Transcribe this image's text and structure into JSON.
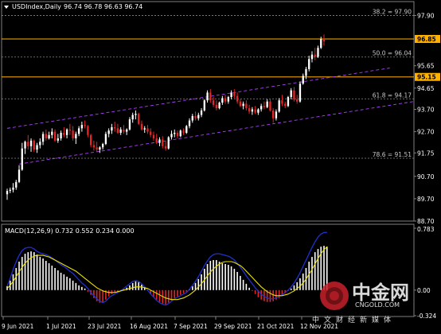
{
  "header": {
    "symbol": "USDIndex,Daily",
    "ohlc": "96.74 96.78 96.63 96.74"
  },
  "chart_data": [
    {
      "type": "candlestick",
      "title": "USDIndex,Daily",
      "ylim": [
        88.7,
        98.45
      ],
      "y_ticks": [
        "97.90",
        "96.85",
        "95.65",
        "95.15",
        "94.65",
        "93.70",
        "92.70",
        "91.75",
        "90.70",
        "89.70",
        "88.70"
      ],
      "x_ticks": [
        "9 Jun 2021",
        "1 Jul 2021",
        "23 Jul 2021",
        "16 Aug 2021",
        "7 Sep 2021",
        "29 Sep 2021",
        "21 Oct 2021",
        "12 Nov 2021"
      ],
      "fib_levels": [
        {
          "label": "38.2 = 97.90",
          "value": 97.9
        },
        {
          "label": "50.0 = 96.04",
          "value": 96.04
        },
        {
          "label": "61.8 = 94.17",
          "value": 94.17
        },
        {
          "label": "78.6 = 91.51",
          "value": 91.51
        }
      ],
      "horizontal_lines": [
        {
          "value": 96.85,
          "label": "96.85",
          "color": "#ffb000"
        },
        {
          "value": 95.15,
          "label": "95.15",
          "color": "#ffb000"
        }
      ],
      "channel": {
        "upper": [
          [
            0,
            92.85
          ],
          [
            128,
            95.55
          ]
        ],
        "lower": [
          [
            4,
            91.25
          ],
          [
            136,
            94.05
          ]
        ]
      },
      "candles": [
        [
          89.9,
          90.15,
          89.65,
          90.05
        ],
        [
          90.05,
          90.2,
          89.95,
          90.1
        ],
        [
          90.1,
          90.4,
          89.98,
          90.2
        ],
        [
          90.2,
          90.55,
          90.1,
          90.45
        ],
        [
          90.45,
          91.2,
          90.4,
          91.0
        ],
        [
          91.0,
          92.2,
          90.95,
          91.95
        ],
        [
          91.95,
          92.3,
          91.7,
          92.25
        ],
        [
          92.25,
          92.55,
          91.9,
          92.05
        ],
        [
          92.05,
          92.4,
          91.8,
          92.3
        ],
        [
          92.3,
          92.35,
          91.8,
          91.9
        ],
        [
          91.9,
          92.2,
          91.75,
          92.1
        ],
        [
          92.1,
          92.4,
          91.95,
          92.25
        ],
        [
          92.25,
          92.7,
          92.1,
          92.6
        ],
        [
          92.6,
          92.8,
          92.3,
          92.4
        ],
        [
          92.4,
          92.7,
          92.35,
          92.55
        ],
        [
          92.55,
          92.85,
          92.4,
          92.7
        ],
        [
          92.7,
          92.8,
          92.25,
          92.3
        ],
        [
          92.3,
          92.6,
          92.2,
          92.4
        ],
        [
          92.4,
          92.75,
          92.3,
          92.65
        ],
        [
          92.65,
          92.9,
          92.45,
          92.55
        ],
        [
          92.55,
          92.85,
          92.4,
          92.8
        ],
        [
          92.8,
          93.05,
          92.55,
          92.75
        ],
        [
          92.75,
          92.95,
          92.3,
          92.4
        ],
        [
          92.4,
          92.7,
          92.15,
          92.6
        ],
        [
          92.6,
          92.95,
          92.5,
          92.85
        ],
        [
          92.85,
          93.15,
          92.7,
          93.0
        ],
        [
          93.0,
          93.2,
          92.85,
          92.95
        ],
        [
          92.95,
          93.0,
          92.45,
          92.55
        ],
        [
          92.55,
          92.6,
          92.0,
          92.1
        ],
        [
          92.1,
          92.3,
          91.85,
          92.0
        ],
        [
          92.0,
          92.25,
          91.8,
          91.9
        ],
        [
          91.9,
          92.05,
          91.75,
          92.0
        ],
        [
          92.0,
          92.2,
          91.9,
          92.15
        ],
        [
          92.15,
          92.7,
          92.1,
          92.6
        ],
        [
          92.6,
          92.85,
          92.45,
          92.75
        ],
        [
          92.75,
          93.05,
          92.6,
          92.9
        ],
        [
          92.9,
          93.15,
          92.7,
          92.85
        ],
        [
          92.85,
          93.05,
          92.6,
          92.65
        ],
        [
          92.65,
          92.9,
          92.55,
          92.8
        ],
        [
          92.8,
          93.0,
          92.6,
          92.7
        ],
        [
          92.7,
          92.85,
          92.55,
          92.8
        ],
        [
          92.8,
          93.35,
          92.75,
          93.25
        ],
        [
          93.25,
          93.55,
          93.1,
          93.45
        ],
        [
          93.45,
          93.65,
          93.25,
          93.5
        ],
        [
          93.5,
          93.55,
          93.0,
          93.05
        ],
        [
          93.05,
          93.2,
          92.75,
          92.8
        ],
        [
          92.8,
          92.95,
          92.65,
          92.85
        ],
        [
          92.85,
          93.0,
          92.6,
          92.7
        ],
        [
          92.7,
          92.85,
          92.45,
          92.55
        ],
        [
          92.55,
          92.7,
          92.3,
          92.4
        ],
        [
          92.4,
          92.6,
          92.15,
          92.2
        ],
        [
          92.2,
          92.45,
          92.05,
          92.35
        ],
        [
          92.35,
          92.5,
          91.95,
          92.05
        ],
        [
          92.05,
          92.3,
          91.85,
          91.95
        ],
        [
          91.95,
          92.5,
          91.9,
          92.45
        ],
        [
          92.45,
          92.75,
          92.35,
          92.6
        ],
        [
          92.6,
          92.8,
          92.45,
          92.65
        ],
        [
          92.65,
          92.75,
          92.4,
          92.5
        ],
        [
          92.5,
          92.8,
          92.45,
          92.75
        ],
        [
          92.75,
          92.85,
          92.55,
          92.65
        ],
        [
          92.65,
          93.0,
          92.6,
          92.95
        ],
        [
          92.95,
          93.3,
          92.85,
          93.2
        ],
        [
          93.2,
          93.5,
          93.1,
          93.4
        ],
        [
          93.4,
          93.6,
          93.2,
          93.3
        ],
        [
          93.3,
          93.55,
          93.2,
          93.45
        ],
        [
          93.45,
          93.75,
          93.35,
          93.65
        ],
        [
          93.65,
          94.15,
          93.6,
          94.1
        ],
        [
          94.1,
          94.55,
          94.0,
          94.45
        ],
        [
          94.45,
          94.6,
          94.0,
          94.1
        ],
        [
          94.1,
          94.25,
          93.8,
          93.9
        ],
        [
          93.9,
          94.1,
          93.65,
          93.75
        ],
        [
          93.75,
          94.05,
          93.7,
          94.0
        ],
        [
          94.0,
          94.3,
          93.9,
          94.2
        ],
        [
          94.2,
          94.35,
          93.95,
          94.05
        ],
        [
          94.05,
          94.3,
          93.95,
          94.25
        ],
        [
          94.25,
          94.55,
          94.15,
          94.45
        ],
        [
          94.45,
          94.6,
          94.2,
          94.3
        ],
        [
          94.3,
          94.45,
          93.95,
          94.05
        ],
        [
          94.05,
          94.15,
          93.8,
          93.85
        ],
        [
          93.85,
          94.05,
          93.7,
          93.95
        ],
        [
          93.95,
          94.1,
          93.65,
          93.75
        ],
        [
          93.75,
          93.9,
          93.5,
          93.6
        ],
        [
          93.6,
          93.8,
          93.45,
          93.7
        ],
        [
          93.7,
          93.85,
          93.5,
          93.55
        ],
        [
          93.55,
          93.75,
          93.45,
          93.7
        ],
        [
          93.7,
          93.95,
          93.6,
          93.85
        ],
        [
          93.85,
          94.05,
          93.7,
          93.8
        ],
        [
          93.8,
          94.15,
          93.75,
          94.05
        ],
        [
          94.05,
          94.15,
          93.6,
          93.65
        ],
        [
          93.65,
          93.75,
          93.1,
          93.3
        ],
        [
          93.3,
          93.7,
          93.2,
          93.6
        ],
        [
          93.6,
          94.2,
          93.55,
          94.1
        ],
        [
          94.1,
          94.35,
          93.85,
          93.95
        ],
        [
          93.95,
          94.05,
          93.75,
          93.85
        ],
        [
          93.85,
          94.3,
          93.8,
          94.25
        ],
        [
          94.25,
          94.65,
          94.15,
          94.55
        ],
        [
          94.55,
          94.7,
          94.05,
          94.15
        ],
        [
          94.15,
          94.35,
          93.95,
          94.05
        ],
        [
          94.05,
          94.95,
          94.0,
          94.85
        ],
        [
          94.85,
          95.3,
          94.8,
          95.2
        ],
        [
          95.2,
          95.6,
          95.05,
          95.5
        ],
        [
          95.5,
          96.1,
          95.4,
          95.95
        ],
        [
          95.95,
          96.3,
          95.8,
          96.15
        ],
        [
          96.15,
          96.45,
          95.9,
          96.05
        ],
        [
          96.05,
          96.55,
          96.0,
          96.45
        ],
        [
          96.45,
          96.95,
          96.4,
          96.85
        ],
        [
          96.85,
          97.05,
          96.55,
          96.74
        ]
      ]
    },
    {
      "type": "macd",
      "title": "MACD(12,26,9) 0.732 0.552 0.234 0.000",
      "ylim": [
        -0.324,
        0.783
      ],
      "y_ticks": [
        "0.783",
        "0.00",
        "-0.324"
      ],
      "histogram": [
        0.05,
        0.12,
        0.2,
        0.28,
        0.36,
        0.42,
        0.46,
        0.48,
        0.49,
        0.48,
        0.45,
        0.42,
        0.4,
        0.37,
        0.34,
        0.31,
        0.28,
        0.25,
        0.22,
        0.2,
        0.17,
        0.15,
        0.12,
        0.09,
        0.06,
        0.04,
        0.02,
        -0.02,
        -0.06,
        -0.1,
        -0.14,
        -0.16,
        -0.15,
        -0.12,
        -0.08,
        -0.05,
        -0.03,
        -0.02,
        -0.01,
        0.01,
        0.03,
        0.06,
        0.09,
        0.11,
        0.1,
        0.07,
        0.03,
        -0.01,
        -0.05,
        -0.09,
        -0.12,
        -0.15,
        -0.17,
        -0.18,
        -0.16,
        -0.13,
        -0.1,
        -0.08,
        -0.06,
        -0.04,
        -0.02,
        0.01,
        0.05,
        0.09,
        0.14,
        0.2,
        0.27,
        0.33,
        0.37,
        0.38,
        0.38,
        0.36,
        0.34,
        0.33,
        0.32,
        0.3,
        0.27,
        0.23,
        0.18,
        0.13,
        0.08,
        0.03,
        -0.01,
        -0.05,
        -0.09,
        -0.12,
        -0.14,
        -0.15,
        -0.15,
        -0.14,
        -0.12,
        -0.1,
        -0.07,
        -0.04,
        -0.01,
        0.02,
        0.06,
        0.1,
        0.15,
        0.21,
        0.28,
        0.36,
        0.42,
        0.48,
        0.52,
        0.55,
        0.56,
        0.55
      ],
      "signal": [
        0.02,
        0.06,
        0.11,
        0.17,
        0.23,
        0.29,
        0.34,
        0.38,
        0.41,
        0.43,
        0.44,
        0.44,
        0.44,
        0.43,
        0.42,
        0.4,
        0.38,
        0.36,
        0.34,
        0.32,
        0.3,
        0.28,
        0.26,
        0.24,
        0.21,
        0.18,
        0.15,
        0.12,
        0.09,
        0.06,
        0.03,
        0.01,
        -0.01,
        -0.02,
        -0.03,
        -0.03,
        -0.03,
        -0.02,
        -0.01,
        0.0,
        0.01,
        0.02,
        0.03,
        0.04,
        0.04,
        0.04,
        0.03,
        0.02,
        0.0,
        -0.02,
        -0.04,
        -0.06,
        -0.08,
        -0.1,
        -0.11,
        -0.12,
        -0.12,
        -0.12,
        -0.11,
        -0.1,
        -0.08,
        -0.06,
        -0.03,
        0.0,
        0.04,
        0.08,
        0.13,
        0.18,
        0.23,
        0.27,
        0.3,
        0.33,
        0.35,
        0.36,
        0.36,
        0.36,
        0.35,
        0.33,
        0.31,
        0.28,
        0.24,
        0.2,
        0.16,
        0.12,
        0.08,
        0.04,
        0.01,
        -0.02,
        -0.04,
        -0.06,
        -0.07,
        -0.07,
        -0.07,
        -0.06,
        -0.05,
        -0.03,
        -0.01,
        0.02,
        0.05,
        0.09,
        0.14,
        0.2,
        0.26,
        0.33,
        0.4,
        0.46,
        0.51,
        0.55
      ],
      "macd": [
        0.05,
        0.15,
        0.26,
        0.36,
        0.44,
        0.5,
        0.53,
        0.54,
        0.54,
        0.52,
        0.49,
        0.47,
        0.46,
        0.45,
        0.43,
        0.41,
        0.38,
        0.35,
        0.32,
        0.3,
        0.27,
        0.24,
        0.21,
        0.17,
        0.13,
        0.09,
        0.06,
        0.02,
        -0.03,
        -0.07,
        -0.11,
        -0.14,
        -0.16,
        -0.14,
        -0.1,
        -0.07,
        -0.05,
        -0.03,
        -0.01,
        0.02,
        0.05,
        0.08,
        0.11,
        0.12,
        0.11,
        0.08,
        0.04,
        0.0,
        -0.05,
        -0.09,
        -0.13,
        -0.16,
        -0.18,
        -0.19,
        -0.17,
        -0.14,
        -0.11,
        -0.09,
        -0.07,
        -0.05,
        -0.03,
        0.01,
        0.06,
        0.11,
        0.17,
        0.24,
        0.31,
        0.37,
        0.42,
        0.45,
        0.46,
        0.46,
        0.45,
        0.44,
        0.43,
        0.41,
        0.38,
        0.34,
        0.29,
        0.24,
        0.18,
        0.13,
        0.08,
        0.03,
        -0.01,
        -0.05,
        -0.08,
        -0.1,
        -0.11,
        -0.11,
        -0.1,
        -0.08,
        -0.06,
        -0.03,
        0.0,
        0.04,
        0.09,
        0.15,
        0.22,
        0.3,
        0.38,
        0.46,
        0.54,
        0.61,
        0.67,
        0.71,
        0.73,
        0.73
      ]
    }
  ],
  "watermark": {
    "brand": "中金网",
    "domain": "CNGOLD.COM",
    "slogan": "中文财经新媒体"
  },
  "colors": {
    "bull": "#ffffff",
    "bear": "#e32626",
    "fib": "#8c8c8c",
    "level": "#ffb000",
    "channel": "#b040ff",
    "macd": "#2030d0",
    "signal": "#e8e000",
    "hist_pos": "#ffffff",
    "hist_neg": "#e32626"
  }
}
